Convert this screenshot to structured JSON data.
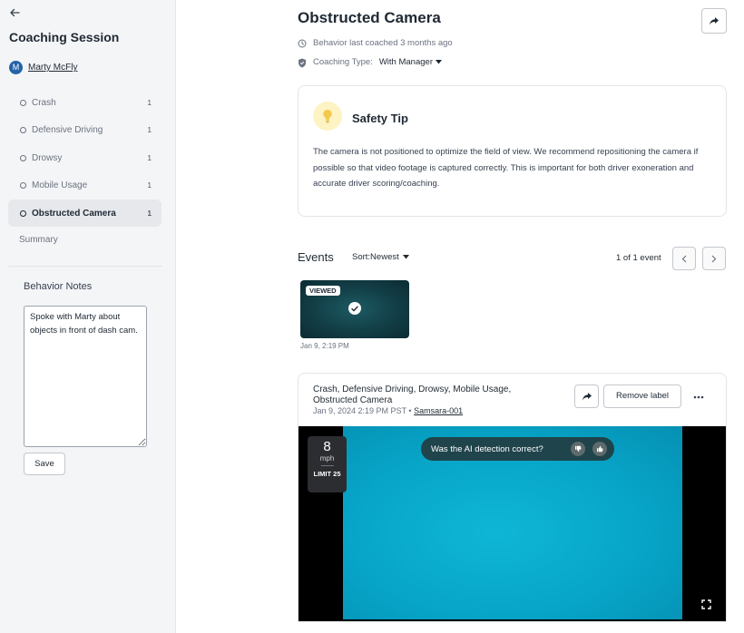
{
  "sidebar": {
    "back_icon": "arrow-left-icon",
    "title": "Coaching Session",
    "driver": {
      "initial": "M",
      "name": "Marty McFly"
    },
    "behaviors": [
      {
        "label": "Crash",
        "count": "1",
        "active": false
      },
      {
        "label": "Defensive Driving",
        "count": "1",
        "active": false
      },
      {
        "label": "Drowsy",
        "count": "1",
        "active": false
      },
      {
        "label": "Mobile Usage",
        "count": "1",
        "active": false
      },
      {
        "label": "Obstructed Camera",
        "count": "1",
        "active": true
      }
    ],
    "summary_label": "Summary",
    "notes_label": "Behavior Notes",
    "notes_value": "Spoke with Marty about objects in front of dash cam.",
    "save_label": "Save"
  },
  "main": {
    "title": "Obstructed Camera",
    "last_coached": "Behavior last coached 3 months ago",
    "coaching_type_label": "Coaching Type:",
    "coaching_type_value": "With Manager",
    "tip": {
      "title": "Safety Tip",
      "body": "The camera is not positioned to optimize the field of view. We recommend repositioning the camera if possible so that video footage is captured correctly. This is important for both driver exoneration and accurate driver scoring/coaching."
    },
    "events": {
      "label": "Events",
      "sort": "Sort:Newest",
      "page_count": "1 of 1 event",
      "thumbnail": {
        "badge": "VIEWED",
        "date": "Jan 9, 2:19 PM"
      }
    },
    "event_detail": {
      "labels": "Crash, Defensive Driving, Drowsy, Mobile Usage, Obstructed Camera",
      "timestamp": "Jan 9, 2024 2:19 PM PST",
      "separator": "•",
      "vehicle": "Samsara-001",
      "remove_label": "Remove label",
      "speed": {
        "value": "8",
        "unit": "mph",
        "limit": "LIMIT 25"
      },
      "ai_question": "Was the AI detection correct?"
    }
  },
  "colors": {
    "accent": "#2563a8",
    "sidebar_bg": "#f4f5f7",
    "tip_icon_bg": "#fdf3c3",
    "video_frame": "#07a5c8"
  }
}
